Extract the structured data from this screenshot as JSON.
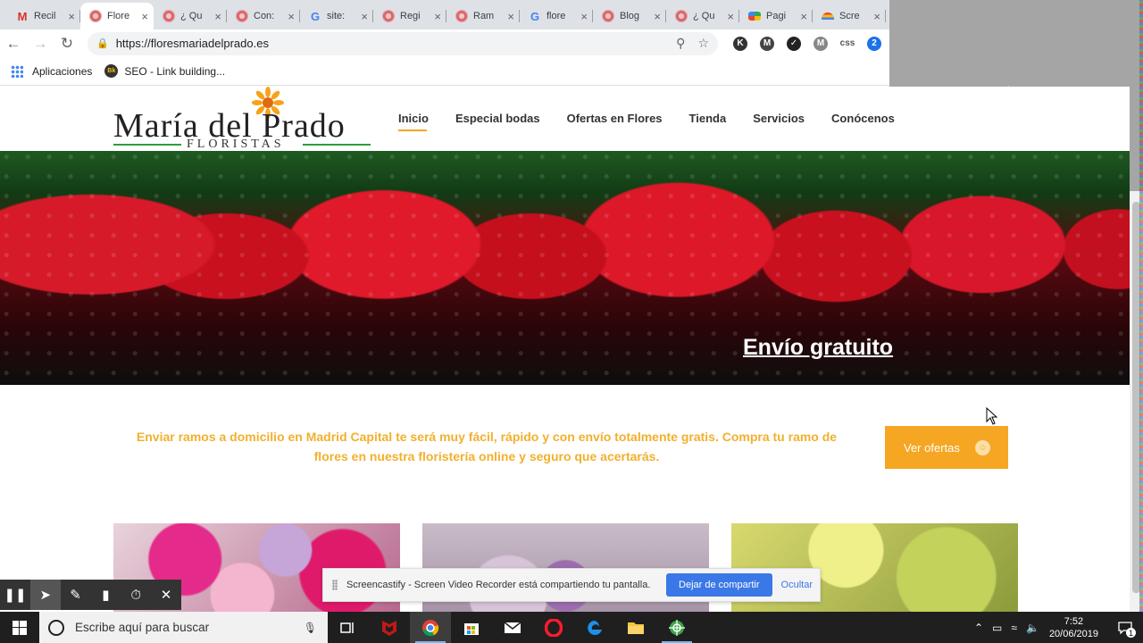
{
  "browser": {
    "tabs": [
      {
        "label": "Recil",
        "favicon": "gmail-icon",
        "active": false
      },
      {
        "label": "Flore",
        "favicon": "flower-icon",
        "active": true
      },
      {
        "label": "¿ Qu",
        "favicon": "flower-icon",
        "active": false
      },
      {
        "label": "Con:",
        "favicon": "flower-icon",
        "active": false
      },
      {
        "label": "site:",
        "favicon": "google-icon",
        "active": false
      },
      {
        "label": "Regi",
        "favicon": "flower-icon",
        "active": false
      },
      {
        "label": "Ram",
        "favicon": "flower-icon",
        "active": false
      },
      {
        "label": "flore",
        "favicon": "google-icon",
        "active": false
      },
      {
        "label": "Blog",
        "favicon": "flower-icon",
        "active": false
      },
      {
        "label": "¿ Qu",
        "favicon": "flower-icon",
        "active": false
      },
      {
        "label": "Pagi",
        "favicon": "dots-icon",
        "active": false
      },
      {
        "label": "Scre",
        "favicon": "screencastify-icon",
        "active": false
      }
    ],
    "url": "https://floresmariadelprado.es",
    "extensions": [
      {
        "letter": "K",
        "color": "#333333"
      },
      {
        "letter": "M",
        "color": "#444444"
      },
      {
        "letter": "✓",
        "color": "#222222"
      },
      {
        "letter": "M",
        "color": "#888888"
      },
      {
        "letter": "css",
        "color": "#ffffff"
      },
      {
        "letter": "2",
        "color": "#1a73e8"
      }
    ],
    "bookmarks": [
      {
        "label": "Aplicaciones",
        "icon": "apps-grid-icon"
      },
      {
        "label": "SEO - Link building...",
        "icon": "seo-icon"
      }
    ]
  },
  "site": {
    "logo": {
      "brand": "María del Prado",
      "sub": "FLORISTAS"
    },
    "menu": [
      {
        "label": "Inicio",
        "active": true
      },
      {
        "label": "Especial bodas",
        "active": false
      },
      {
        "label": "Ofertas en Flores",
        "active": false
      },
      {
        "label": "Tienda",
        "active": false
      },
      {
        "label": "Servicios",
        "active": false
      },
      {
        "label": "Conócenos",
        "active": false
      }
    ],
    "hero_caption": "Envío gratuito",
    "promo_text": "Enviar ramos a domicilio en Madrid Capital te será muy fácil, rápido y con envío totalmente gratis. Compra tu ramo de flores en nuestra floristería online y seguro que acertarás.",
    "cta_label": "Ver ofertas",
    "accent_color": "#f5a623"
  },
  "screencastify": {
    "tools": [
      "pause-icon",
      "pointer-icon",
      "pen-icon",
      "eraser-icon",
      "timer-icon",
      "close-icon"
    ],
    "share_message": "Screencastify - Screen Video Recorder está compartiendo tu pantalla.",
    "stop_label": "Dejar de compartir",
    "hide_label": "Ocultar"
  },
  "taskbar": {
    "search_placeholder": "Escribe aquí para buscar",
    "time": "7:52",
    "date": "20/06/2019",
    "notification_count": "1"
  }
}
